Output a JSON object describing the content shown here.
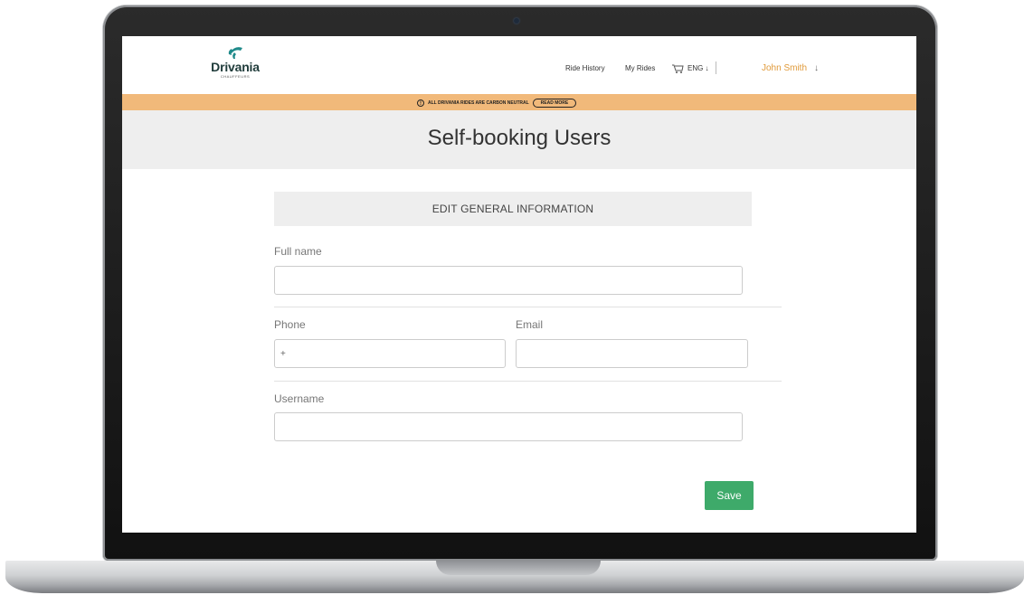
{
  "brand": {
    "name": "Drivania",
    "tagline": "CHAUFFEURS",
    "color": "#1f3b3a",
    "icon_color": "#1f8a8a"
  },
  "nav": {
    "ride_history": "Ride History",
    "my_rides": "My Rides",
    "language": "ENG ↓",
    "user_name": "John Smith",
    "user_arrow": "↓",
    "cart_icon": "cart-icon"
  },
  "banner": {
    "message": "ALL DRIVANIA RIDES ARE CARBON NEUTRAL",
    "button": "READ MORE",
    "info_glyph": "!",
    "color": "#f1b97a"
  },
  "page": {
    "title": "Self-booking Users"
  },
  "form": {
    "section_title": "EDIT GENERAL INFORMATION",
    "full_name_label": "Full name",
    "full_name_value": "",
    "phone_label": "Phone",
    "phone_value": "+",
    "email_label": "Email",
    "email_value": "",
    "username_label": "Username",
    "username_value": "",
    "save_label": "Save",
    "save_color": "#3eaa6a"
  },
  "colors": {
    "accent_user": "#e09a3a",
    "title_band": "#eeeeee"
  }
}
